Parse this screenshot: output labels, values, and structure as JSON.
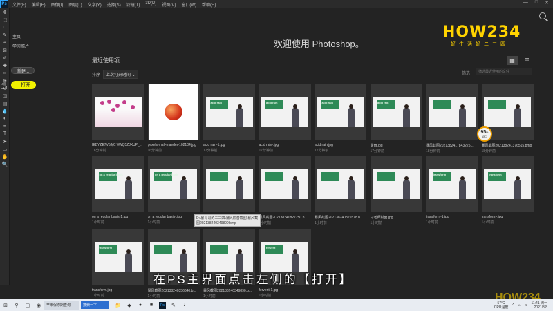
{
  "app": {
    "logo_text": "Ps"
  },
  "menu": [
    "文件(F)",
    "编辑(E)",
    "图像(I)",
    "图层(L)",
    "文字(Y)",
    "选择(S)",
    "滤镜(T)",
    "3D(D)",
    "视图(V)",
    "窗口(W)",
    "帮助(H)"
  ],
  "window_controls": [
    "—",
    "□",
    "✕"
  ],
  "left_panel": {
    "tab_home": "主页",
    "tab_learn": "学习照片",
    "new_label": "新建...",
    "open_label": "打开"
  },
  "toolbar_icons": [
    "move-icon",
    "marquee-icon",
    "lasso-icon",
    "quick-select-icon",
    "crop-icon",
    "frame-icon",
    "eyedropper-icon",
    "healing-icon",
    "brush-icon",
    "stamp-icon",
    "history-brush-icon",
    "eraser-icon",
    "gradient-icon",
    "blur-icon",
    "dodge-icon",
    "pen-icon",
    "type-icon",
    "path-select-icon",
    "rectangle-icon",
    "hand-icon",
    "zoom-icon"
  ],
  "welcome": {
    "title": "欢迎使用 Photoshop。"
  },
  "logo": {
    "word": "HOW234",
    "sub": "好生活好二三四"
  },
  "recent": {
    "title": "最近使用项",
    "sort_label": "排序",
    "sort_value": "上次打开时间",
    "filter_label": "筛选",
    "filter_placeholder": "筛选最近使用的文件"
  },
  "files": [
    {
      "name": "IEBYZE7V5J(C`0WQ5ZJXUP_...",
      "time": "16分钟前",
      "kind": "flower"
    },
    {
      "name": "pexels-mali-maeder-102104.jpg",
      "time": "16分钟前",
      "kind": "apple"
    },
    {
      "name": "acid rain-1.jpg",
      "time": "17分钟前",
      "kind": "slide",
      "board": "acid rain"
    },
    {
      "name": "acid rain-.jpg",
      "time": "17分钟前",
      "kind": "slide",
      "board": "acid rain"
    },
    {
      "name": "acid rain.jpg",
      "time": "17分钟前",
      "kind": "slide",
      "board": "acid rain"
    },
    {
      "name": "酸雨.jpg",
      "time": "17分钟前",
      "kind": "slide",
      "board": "acid rain"
    },
    {
      "name": "暴风截图2021382417843225...",
      "time": "18分钟前",
      "kind": "slide",
      "board": ""
    },
    {
      "name": "暴风截图202138241376515.bmp",
      "time": "18分钟前",
      "kind": "slide",
      "board": ""
    },
    {
      "name": "on a regular basis-1.jpg",
      "time": "1小时前",
      "kind": "slide",
      "board": "on a regular basis"
    },
    {
      "name": "on a regular basis-.jpg",
      "time": "1小时前",
      "kind": "slide",
      "board": "on a regular basis"
    },
    {
      "name": "D:\\暴哥哥的二三四\\暴风影音截图\\暴风截图202138240349890.bmp",
      "time": "1小时前",
      "kind": "slide",
      "board": ""
    },
    {
      "name": "暴风截图202138240827250.b...",
      "time": "1小时前",
      "kind": "slide",
      "board": ""
    },
    {
      "name": "暴风截图202138240825578.b...",
      "time": "1小时前",
      "kind": "slide",
      "board": ""
    },
    {
      "name": "马老师封面.jpg",
      "time": "1小时前",
      "kind": "slide",
      "board": ""
    },
    {
      "name": "transform-1.jpg",
      "time": "1小时前",
      "kind": "slide",
      "board": "transform"
    },
    {
      "name": "transform-.jpg",
      "time": "1小时前",
      "kind": "slide",
      "board": "transform"
    },
    {
      "name": "transform.jpg",
      "time": "1小时前",
      "kind": "slide",
      "board": "transform"
    },
    {
      "name": "暴风截图202138240356640.b...",
      "time": "1小时前",
      "kind": "slide",
      "board": ""
    },
    {
      "name": "暴风截图202138240349890.b...",
      "time": "1小时前",
      "kind": "slide",
      "board": ""
    },
    {
      "name": "fervent-1.jpg",
      "time": "1小时前",
      "kind": "slide",
      "board": "fervent"
    }
  ],
  "tooltip": "D:\\暴哥哥的二三四\\暴风影音截图\\暴风截图202138240349890.bmp",
  "badge": {
    "value": "95",
    "unit": "%",
    "sub": "ØC"
  },
  "subtitle": "在PS主界面点击左侧的【打开】",
  "watermark": "HOW234",
  "taskbar": {
    "browser_label": "苹果保修期查询",
    "search_label": "搜索一下",
    "temperature": "57°C",
    "cpu": "CPU温度",
    "time": "11:41 周一",
    "date": "2021/3/8"
  }
}
